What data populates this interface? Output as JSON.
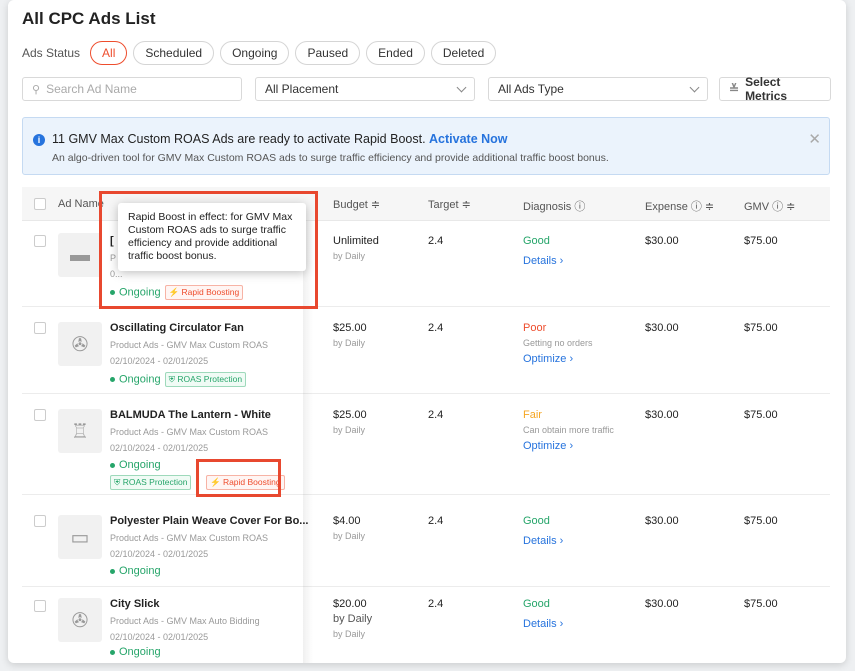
{
  "page": {
    "title": "All CPC Ads List"
  },
  "status": {
    "label": "Ads Status",
    "tabs": [
      "All",
      "Scheduled",
      "Ongoing",
      "Paused",
      "Ended",
      "Deleted"
    ]
  },
  "filters": {
    "search_placeholder": "Search Ad Name",
    "placement": "All Placement",
    "ads_type": "All Ads Type",
    "metrics": "Select Metrics"
  },
  "banner": {
    "line1": "11 GMV Max Custom ROAS Ads are ready to activate Rapid Boost.",
    "link": "Activate Now",
    "line2": "An algo-driven tool for GMV Max Custom ROAS ads to surge traffic efficiency and provide additional traffic boost bonus."
  },
  "table": {
    "headers": {
      "ad_name": "Ad Name",
      "budget": "Budget ≑",
      "target": "Target ≑",
      "diagnosis": "Diagnosis ⓘ",
      "expense": "Expense ⓘ ≑",
      "gmv": "GMV ⓘ ≑"
    },
    "rows": [
      {
        "name": "[",
        "sub": "P",
        "date": "0...",
        "status": "Ongoing",
        "tag1": "⚡ Rapid Boosting",
        "tag2": "",
        "budget": "Unlimited",
        "budget_sub": "by Daily",
        "budget_sub2": "",
        "target": "2.4",
        "diag": "Good",
        "diag_sub": "",
        "action": "Details ›",
        "expense": "$30.00",
        "gmv": "$75.00"
      },
      {
        "name": "Oscillating Circulator Fan",
        "sub": "Product Ads - GMV Max Custom ROAS",
        "date": "02/10/2024 - 02/01/2025",
        "status": "Ongoing",
        "tag1": "",
        "tag2": "⛨ ROAS Protection",
        "budget": "$25.00",
        "budget_sub": "by Daily",
        "budget_sub2": "",
        "target": "2.4",
        "diag": "Poor",
        "diag_sub": "Getting no orders",
        "action": "Optimize ›",
        "expense": "$30.00",
        "gmv": "$75.00"
      },
      {
        "name": "BALMUDA The Lantern - White",
        "sub": "Product Ads - GMV Max Custom ROAS",
        "date": "02/10/2024 - 02/01/2025",
        "status": "Ongoing",
        "tag1": "⚡ Rapid Boosting",
        "tag2": "⛨ ROAS Protection",
        "budget": "$25.00",
        "budget_sub": "by Daily",
        "budget_sub2": "",
        "target": "2.4",
        "diag": "Fair",
        "diag_sub": "Can obtain more traffic",
        "action": "Optimize ›",
        "expense": "$30.00",
        "gmv": "$75.00"
      },
      {
        "name": "Polyester Plain Weave Cover For Bo...",
        "sub": "Product Ads - GMV Max Custom ROAS",
        "date": "02/10/2024 - 02/01/2025",
        "status": "Ongoing",
        "tag1": "",
        "tag2": "",
        "budget": "$4.00",
        "budget_sub": "by Daily",
        "budget_sub2": "",
        "target": "2.4",
        "diag": "Good",
        "diag_sub": "",
        "action": "Details ›",
        "expense": "$30.00",
        "gmv": "$75.00"
      },
      {
        "name": "City Slick",
        "sub": "Product Ads - GMV Max Auto Bidding",
        "date": "02/10/2024 - 02/01/2025",
        "status": "Ongoing",
        "tag1": "",
        "tag2": "",
        "budget": "$20.00",
        "budget_sub": "by Daily",
        "budget_sub2": "by Daily",
        "target": "2.4",
        "diag": "Good",
        "diag_sub": "",
        "action": "Details ›",
        "expense": "$30.00",
        "gmv": "$75.00"
      }
    ]
  },
  "tooltip": {
    "text": "Rapid Boost in effect: for GMV Max Custom ROAS ads to surge traffic efficiency and provide additional traffic boost bonus."
  },
  "colors": {
    "accent": "#ee4d2d",
    "link": "#2673dd",
    "good": "#26a56a",
    "fair": "#f5a623",
    "highlight": "#e8482f"
  }
}
